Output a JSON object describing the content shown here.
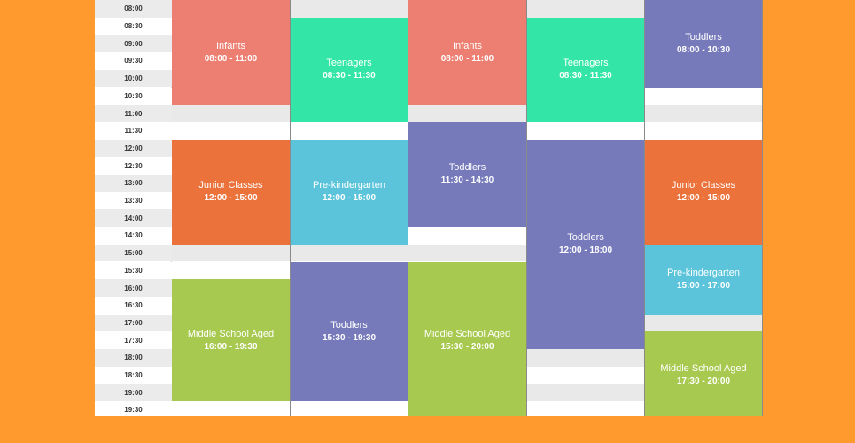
{
  "timetable": {
    "times": [
      "08:00",
      "08:30",
      "09:00",
      "09:30",
      "10:00",
      "10:30",
      "11:00",
      "11:30",
      "12:00",
      "12:30",
      "13:00",
      "13:30",
      "14:00",
      "14:30",
      "15:00",
      "15:30",
      "16:00",
      "16:30",
      "17:00",
      "17:30",
      "18:00",
      "18:30",
      "19:00",
      "19:30"
    ],
    "categories": {
      "Infants": "#EC7F72",
      "Teenagers": "#33E6A7",
      "Toddlers": "#767ABB",
      "Junior Classes": "#EB723B",
      "Pre-kindergarten": "#5BC4DB",
      "Middle School Aged": "#A8C950"
    },
    "columns": [
      {
        "events": [
          {
            "name": "Infants",
            "range": "08:00 - 11:00",
            "start": "08:00",
            "end": "11:00"
          },
          {
            "name": "Junior Classes",
            "range": "12:00 - 15:00",
            "start": "12:00",
            "end": "15:00"
          },
          {
            "name": "Middle School Aged",
            "range": "16:00 - 19:30",
            "start": "16:00",
            "end": "19:30"
          }
        ]
      },
      {
        "events": [
          {
            "name": "Teenagers",
            "range": "08:30 - 11:30",
            "start": "08:30",
            "end": "11:30"
          },
          {
            "name": "Pre-kindergarten",
            "range": "12:00 - 15:00",
            "start": "12:00",
            "end": "15:00"
          },
          {
            "name": "Toddlers",
            "range": "15:30 - 19:30",
            "start": "15:30",
            "end": "19:30"
          }
        ]
      },
      {
        "events": [
          {
            "name": "Infants",
            "range": "08:00 - 11:00",
            "start": "08:00",
            "end": "11:00"
          },
          {
            "name": "Toddlers",
            "range": "11:30 - 14:30",
            "start": "11:30",
            "end": "14:30"
          },
          {
            "name": "Middle School Aged",
            "range": "15:30 - 20:00",
            "start": "15:30",
            "end": "20:00"
          }
        ]
      },
      {
        "events": [
          {
            "name": "Teenagers",
            "range": "08:30 - 11:30",
            "start": "08:30",
            "end": "11:30"
          },
          {
            "name": "Toddlers",
            "range": "12:00 - 18:00",
            "start": "12:00",
            "end": "18:00"
          }
        ]
      },
      {
        "events": [
          {
            "name": "Toddlers",
            "range": "08:00 - 10:30",
            "start": "08:00",
            "end": "10:30"
          },
          {
            "name": "Junior Classes",
            "range": "12:00 - 15:00",
            "start": "12:00",
            "end": "15:00"
          },
          {
            "name": "Pre-kindergarten",
            "range": "15:00 - 17:00",
            "start": "15:00",
            "end": "17:00"
          },
          {
            "name": "Middle School Aged",
            "range": "17:30 - 20:00",
            "start": "17:30",
            "end": "20:00"
          }
        ]
      }
    ]
  }
}
